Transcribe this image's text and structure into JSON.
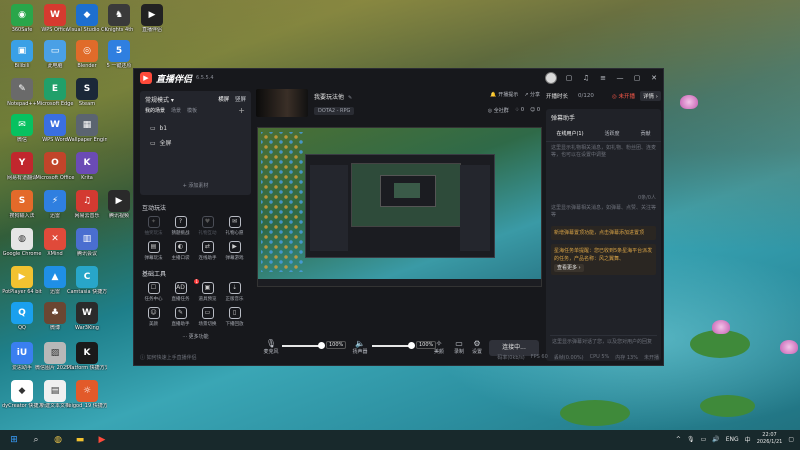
{
  "desktop": {
    "icons": [
      {
        "label": "360Safe",
        "color": "#2aa64a",
        "glyph": "◉"
      },
      {
        "label": "WPS Office",
        "color": "#d63a2f",
        "glyph": "W"
      },
      {
        "label": "Visual Studio Code",
        "color": "#1d6fcf",
        "glyph": "◆"
      },
      {
        "label": "Knights 4th",
        "color": "#3a3a3a",
        "glyph": "♞"
      },
      {
        "label": "直播伴侣",
        "color": "#222",
        "glyph": "▶"
      },
      {
        "label": "Bilibili",
        "color": "#3aa0e6",
        "glyph": "▣"
      },
      {
        "label": "此电脑",
        "color": "#4aa0e6",
        "glyph": "▭"
      },
      {
        "label": "Blender",
        "color": "#e06b2a",
        "glyph": "◎"
      },
      {
        "label": "5 一键还原",
        "color": "#2f7fe0",
        "glyph": "5"
      },
      {
        "label": "Notepad++",
        "color": "#6a6a6a",
        "glyph": "✎"
      },
      {
        "label": "Microsoft Edge",
        "color": "#21a06a",
        "glyph": "E"
      },
      {
        "label": "Steam",
        "color": "#1b2838",
        "glyph": "S"
      },
      {
        "label": "微信",
        "color": "#07c160",
        "glyph": "✉"
      },
      {
        "label": "WPS Word",
        "color": "#3a6fe0",
        "glyph": "W"
      },
      {
        "label": "Wallpaper Engine",
        "color": "#5b6470",
        "glyph": "▦"
      },
      {
        "label": "网易有道翻译",
        "color": "#c1272d",
        "glyph": "Y"
      },
      {
        "label": "Microsoft Office",
        "color": "#c2442a",
        "glyph": "O"
      },
      {
        "label": "Krita",
        "color": "#6b4bb5",
        "glyph": "K"
      },
      {
        "label": "搜狗输入法",
        "color": "#e46a2a",
        "glyph": "S"
      },
      {
        "label": "迅雷",
        "color": "#2f7fe0",
        "glyph": "⚡"
      },
      {
        "label": "网易云音乐",
        "color": "#d33a31",
        "glyph": "♫"
      },
      {
        "label": "腾讯视频",
        "color": "#2a2a2a",
        "glyph": "▶"
      },
      {
        "label": "Google Chrome",
        "color": "#e5e5e5",
        "glyph": "◍"
      },
      {
        "label": "XMind",
        "color": "#e04a3a",
        "glyph": "✕"
      },
      {
        "label": "腾讯会议",
        "color": "#4a6ed0",
        "glyph": "▥"
      },
      {
        "label": "PotPlayer 64 bit",
        "color": "#f2c230",
        "glyph": "▶"
      },
      {
        "label": "迅雷",
        "color": "#1f8fe6",
        "glyph": "▲"
      },
      {
        "label": "Camtasia 快捷方式",
        "color": "#28a6c9",
        "glyph": "C"
      },
      {
        "label": "QQ",
        "color": "#1aa0ee",
        "glyph": "Q"
      },
      {
        "label": "微博",
        "color": "#6b4632",
        "glyph": "♣"
      },
      {
        "label": "War3King",
        "color": "#2b2b2b",
        "glyph": "W"
      },
      {
        "label": "爱思助手",
        "color": "#3a7ff0",
        "glyph": "iU"
      },
      {
        "label": "微信图片 20250...",
        "color": "#b8b8b8",
        "glyph": "▨"
      },
      {
        "label": "Platform 快捷方式",
        "color": "#1a1a1a",
        "glyph": "K"
      },
      {
        "label": "dyCreator 快捷方式",
        "color": "#ffffff",
        "glyph": "◆"
      },
      {
        "label": "新建文本文档",
        "color": "#f0f0f0",
        "glyph": "▤"
      },
      {
        "label": "leigod_19 快捷方式",
        "color": "#e25a2a",
        "glyph": "☼"
      },
      {
        "label": "迅雷下载",
        "color": "#3a8ad6",
        "glyph": "⬇"
      },
      {
        "label": "新建文本文档 (2)",
        "color": "#f0f0f0",
        "glyph": "▤"
      },
      {
        "label": "NVIDIA App",
        "color": "#76b900",
        "glyph": "N"
      },
      {
        "label": "米哈游启动器",
        "color": "#111",
        "glyph": "◈"
      },
      {
        "label": "剪映专业版",
        "color": "#111",
        "glyph": "✂"
      }
    ]
  },
  "app": {
    "title": "直播伴侣",
    "version": "6.5.5.4",
    "left": {
      "mode": "常规模式 ▾",
      "orient_h": "横屏",
      "orient_v": "竖屏",
      "scene_tabs": [
        "我的场景",
        "场景",
        "模板"
      ],
      "scene_add": "+",
      "scenes": [
        "b1",
        "全屏"
      ],
      "add_source": "+ 添加素材",
      "interactive_title": "互动玩法",
      "interactive": [
        {
          "label": "抽奖玩法",
          "glyph": "✦",
          "dim": true
        },
        {
          "label": "猜题挑战",
          "glyph": "?",
          "dim": false
        },
        {
          "label": "礼物互动",
          "glyph": "♥",
          "dim": true
        },
        {
          "label": "礼物心愿",
          "glyph": "✉",
          "dim": false
        },
        {
          "label": "弹幕玩法",
          "glyph": "▤",
          "dim": false
        },
        {
          "label": "主播口袋",
          "glyph": "◐",
          "dim": false
        },
        {
          "label": "连线助手",
          "glyph": "⇄",
          "dim": false
        },
        {
          "label": "弹幕游戏",
          "glyph": "▶",
          "dim": false
        }
      ],
      "tools_title": "基础工具",
      "tools": [
        {
          "label": "任务中心",
          "glyph": "☐",
          "dim": false
        },
        {
          "label": "直播任务",
          "glyph": "AD",
          "dim": false,
          "badge": "1"
        },
        {
          "label": "道具预览",
          "glyph": "▣",
          "dim": false
        },
        {
          "label": "正版音乐",
          "glyph": "⇣",
          "dim": false
        },
        {
          "label": "美颜",
          "glyph": "☺",
          "dim": false
        },
        {
          "label": "直播助手",
          "glyph": "✎",
          "dim": false
        },
        {
          "label": "场景切换",
          "glyph": "▭",
          "dim": false
        },
        {
          "label": "下播回放",
          "glyph": "▯",
          "dim": false
        }
      ],
      "more": "··· 更多功能"
    },
    "center": {
      "live_title": "我要玩法他",
      "category": "DOTA2 - RPG",
      "actions": [
        "开播提示",
        "分享"
      ],
      "stats": [
        "全社群",
        "0",
        "0"
      ],
      "controls": {
        "mic_label": "麦克风",
        "mic_pct": "100%",
        "speaker_label": "扬声器",
        "speaker_pct": "100%",
        "effects_label": "美颜",
        "record_label": "录制",
        "settings_label": "设置",
        "start_label": "连接中..."
      },
      "footer_left": "ⓘ 如何快速上手直播伴侣",
      "footer_stats": [
        "码率(0kb/s)",
        "FPS 60",
        "丢帧(0.00%)",
        "CPU 5%",
        "内存 13%",
        "未开播"
      ]
    },
    "right": {
      "start_time": "开播时长",
      "count": "0/120",
      "live_tag": "◎ 未开播",
      "detail": "详情 ›",
      "danmu_title": "弹幕助手",
      "tabs": [
        "在线用户(1)",
        "活跃度",
        "贡献"
      ],
      "msg1": "这里显示礼物相关消息，如礼物、粉丝团、连麦等，也可以在设置中调整",
      "msg2_count": "0条/0人",
      "msg2": "这里显示弹幕相关消息，如弹幕、点赞、关注等等",
      "notice1": "新增弹幕置顶功能，点击弹幕添加进置顶",
      "notice2": "星海任务单提醒：您已收到5条星海平台派发的任务，产品名称：风之翼舞、",
      "notice_more": "查看更多 ›",
      "input_hint": "这里显示弹幕对话了您，以及您对用户的回复"
    }
  },
  "taskbar": {
    "tray_lang": "ENG",
    "time": "22:07",
    "date": "2026/1/21"
  }
}
